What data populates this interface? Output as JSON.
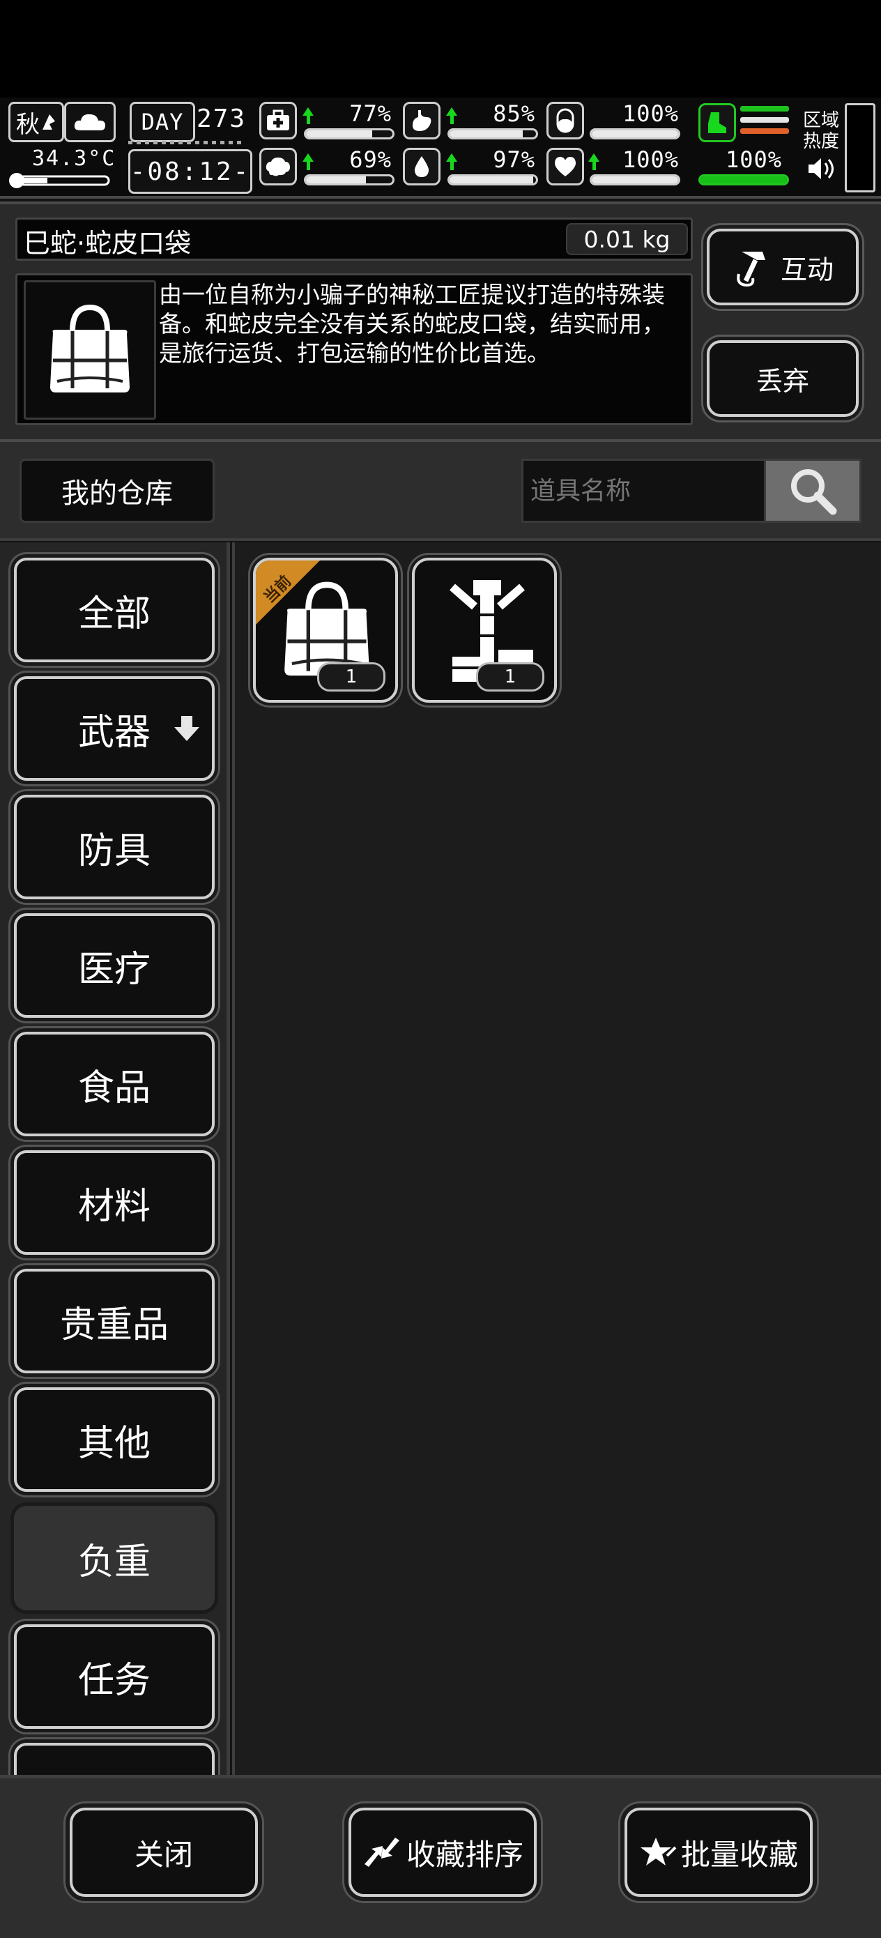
{
  "status": {
    "season": "秋",
    "temperature": "34.3°C",
    "day_label": "DAY",
    "day_number": "273",
    "time": "-08:12-",
    "health_pct": "77%",
    "hunger_pct": "85%",
    "stat3_pct": "100%",
    "mind_pct": "69%",
    "thirst_pct": "97%",
    "heart_pct": "100%",
    "stamina_pct": "100%",
    "health_level": 0.77,
    "hunger_level": 0.85,
    "stat3_level": 1.0,
    "mind_level": 0.69,
    "thirst_level": 0.97,
    "heart_level": 1.0,
    "stamina_level": 1.0,
    "zone_label_1": "区域",
    "zone_label_2": "热度"
  },
  "item": {
    "title": "巳蛇·蛇皮口袋",
    "weight": "0.01 kg",
    "description": "由一位自称为小骗子的神秘工匠提议打造的特殊装备。和蛇皮完全没有关系的蛇皮口袋，结实耐用，是旅行运货、打包运输的性价比首选。",
    "interact_label": "互动",
    "discard_label": "丢弃"
  },
  "warehouse": {
    "label": "我的仓库",
    "search_placeholder": "道具名称"
  },
  "categories": [
    {
      "label": "全部"
    },
    {
      "label": "武器"
    },
    {
      "label": "防具"
    },
    {
      "label": "医疗"
    },
    {
      "label": "食品"
    },
    {
      "label": "材料"
    },
    {
      "label": "贵重品"
    },
    {
      "label": "其他"
    },
    {
      "label": "负重"
    },
    {
      "label": "任务"
    },
    {
      "label": ""
    }
  ],
  "items": [
    {
      "icon": "bag-icon",
      "count": "1",
      "badge": "当前"
    },
    {
      "icon": "rack-icon",
      "count": "1"
    }
  ],
  "bottom": {
    "close_label": "关闭",
    "sort_label": "收藏排序",
    "batch_label": "批量收藏"
  }
}
